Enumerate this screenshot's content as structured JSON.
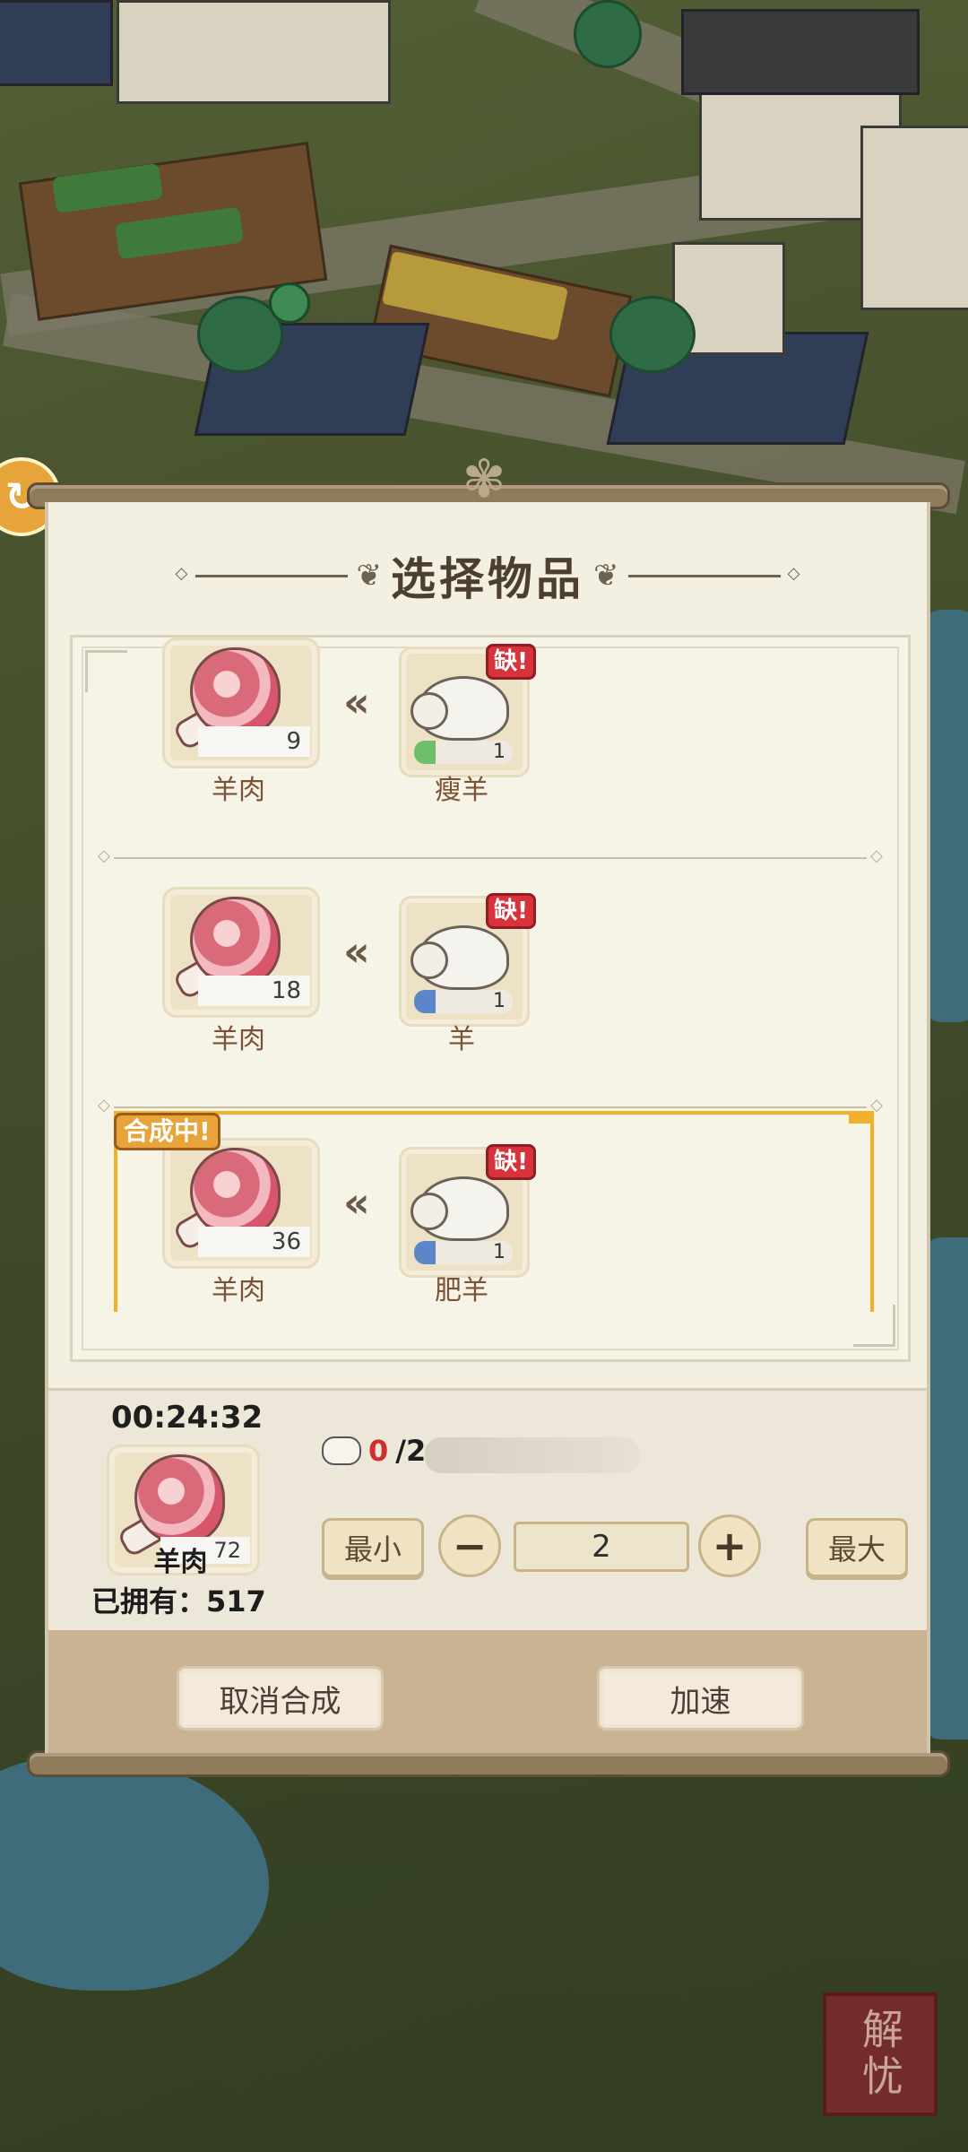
{
  "title": "选择物品",
  "recipes": [
    {
      "output_label": "羊肉",
      "output_count": "9",
      "ingredient_label": "瘦羊",
      "ingredient_count": "1",
      "lack_badge": "缺!",
      "ingredient_color": "#6fbf6a"
    },
    {
      "output_label": "羊肉",
      "output_count": "18",
      "ingredient_label": "羊",
      "ingredient_count": "1",
      "lack_badge": "缺!",
      "ingredient_color": "#5b86c8"
    },
    {
      "output_label": "羊肉",
      "output_count": "36",
      "ingredient_label": "肥羊",
      "ingredient_count": "1",
      "lack_badge": "缺!",
      "ingredient_color": "#5b86c8",
      "status_tag": "合成中!"
    }
  ],
  "detail": {
    "timer": "00:24:32",
    "item_label": "羊肉",
    "item_count": "72",
    "owned_label": "已拥有：",
    "owned_value": "517",
    "requirement_have": "0",
    "requirement_total": "/2",
    "min_label": "最小",
    "max_label": "最大",
    "minus_icon": "minus-icon",
    "plus_icon": "plus-icon",
    "quantity": "2"
  },
  "footer": {
    "cancel_label": "取消合成",
    "speedup_label": "加速"
  },
  "seal_text": "解忧",
  "colors": {
    "accent_gold": "#f0b02a",
    "lack_red": "#d8323b",
    "panel_bg": "#f3efe1"
  }
}
